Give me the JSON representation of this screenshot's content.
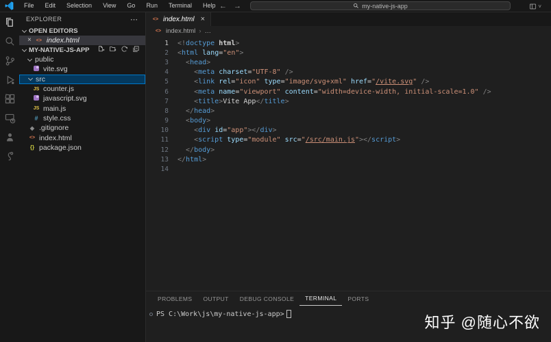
{
  "titlebar": {
    "menus": [
      "File",
      "Edit",
      "Selection",
      "View",
      "Go",
      "Run",
      "Terminal",
      "Help"
    ],
    "back_arrow": "←",
    "forward_arrow": "→",
    "search_value": "my-native-js-app",
    "layout_chevron": "˅"
  },
  "activity_bar": {
    "items": [
      {
        "icon": "explorer",
        "active": true
      },
      {
        "icon": "search",
        "active": false
      },
      {
        "icon": "source-control",
        "active": false
      },
      {
        "icon": "run-debug",
        "active": false
      },
      {
        "icon": "extensions",
        "active": false
      },
      {
        "icon": "remote-explorer",
        "active": false
      },
      {
        "icon": "account",
        "active": false
      },
      {
        "icon": "extension-misc",
        "active": false
      }
    ]
  },
  "sidebar": {
    "title": "EXPLORER",
    "more_label": "⋯",
    "open_editors": {
      "label": "OPEN EDITORS",
      "items": [
        {
          "close": "×",
          "icon": "html",
          "label": "index.html"
        }
      ]
    },
    "project": {
      "label": "MY-NATIVE-JS-APP",
      "actions": [
        "new-file",
        "new-folder",
        "refresh",
        "collapse-all"
      ]
    },
    "tree": [
      {
        "label": "public",
        "type": "folder",
        "indent": 0,
        "expanded": true,
        "selected": false
      },
      {
        "label": "vite.svg",
        "type": "svg",
        "indent": 1,
        "selected": false
      },
      {
        "label": "src",
        "type": "folder",
        "indent": 0,
        "expanded": true,
        "selected": true
      },
      {
        "label": "counter.js",
        "type": "js",
        "indent": 1,
        "selected": false
      },
      {
        "label": "javascript.svg",
        "type": "svg",
        "indent": 1,
        "selected": false
      },
      {
        "label": "main.js",
        "type": "js",
        "indent": 1,
        "selected": false
      },
      {
        "label": "style.css",
        "type": "css",
        "indent": 1,
        "selected": false
      },
      {
        "label": ".gitignore",
        "type": "git",
        "indent": 0,
        "selected": false
      },
      {
        "label": "index.html",
        "type": "html",
        "indent": 0,
        "selected": false
      },
      {
        "label": "package.json",
        "type": "json",
        "indent": 0,
        "selected": false
      }
    ]
  },
  "editor": {
    "tab": {
      "icon": "html",
      "label": "index.html",
      "close": "×"
    },
    "breadcrumb": {
      "file": "index.html",
      "sep": "›",
      "more": "…"
    },
    "code_lines": [
      [
        [
          "p",
          "<!"
        ],
        [
          "t",
          "doctype"
        ],
        [
          "w",
          " "
        ],
        [
          "b",
          "html"
        ],
        [
          "p",
          ">"
        ]
      ],
      [
        [
          "p",
          "<"
        ],
        [
          "t",
          "html"
        ],
        [
          "w",
          " "
        ],
        [
          "a",
          "lang"
        ],
        [
          "e",
          "="
        ],
        [
          "s",
          "\"en\""
        ],
        [
          "p",
          ">"
        ]
      ],
      [
        [
          "g",
          "  "
        ],
        [
          "p",
          "<"
        ],
        [
          "t",
          "head"
        ],
        [
          "p",
          ">"
        ]
      ],
      [
        [
          "g",
          "  "
        ],
        [
          "g",
          "  "
        ],
        [
          "p",
          "<"
        ],
        [
          "t",
          "meta"
        ],
        [
          "w",
          " "
        ],
        [
          "a",
          "charset"
        ],
        [
          "e",
          "="
        ],
        [
          "s",
          "\"UTF-8\""
        ],
        [
          "w",
          " "
        ],
        [
          "p",
          "/>"
        ]
      ],
      [
        [
          "g",
          "  "
        ],
        [
          "g",
          "  "
        ],
        [
          "p",
          "<"
        ],
        [
          "t",
          "link"
        ],
        [
          "w",
          " "
        ],
        [
          "a",
          "rel"
        ],
        [
          "e",
          "="
        ],
        [
          "s",
          "\"icon\""
        ],
        [
          "w",
          " "
        ],
        [
          "a",
          "type"
        ],
        [
          "e",
          "="
        ],
        [
          "s",
          "\"image/svg+xml\""
        ],
        [
          "w",
          " "
        ],
        [
          "a",
          "href"
        ],
        [
          "e",
          "="
        ],
        [
          "s",
          "\""
        ],
        [
          "l",
          "/vite.svg"
        ],
        [
          "s",
          "\""
        ],
        [
          "w",
          " "
        ],
        [
          "p",
          "/>"
        ]
      ],
      [
        [
          "g",
          "  "
        ],
        [
          "g",
          "  "
        ],
        [
          "p",
          "<"
        ],
        [
          "t",
          "meta"
        ],
        [
          "w",
          " "
        ],
        [
          "a",
          "name"
        ],
        [
          "e",
          "="
        ],
        [
          "s",
          "\"viewport\""
        ],
        [
          "w",
          " "
        ],
        [
          "a",
          "content"
        ],
        [
          "e",
          "="
        ],
        [
          "s",
          "\"width=device-width, initial-scale=1.0\""
        ],
        [
          "w",
          " "
        ],
        [
          "p",
          "/>"
        ]
      ],
      [
        [
          "g",
          "  "
        ],
        [
          "g",
          "  "
        ],
        [
          "p",
          "<"
        ],
        [
          "t",
          "title"
        ],
        [
          "p",
          ">"
        ],
        [
          "x",
          "Vite App"
        ],
        [
          "p",
          "</"
        ],
        [
          "t",
          "title"
        ],
        [
          "p",
          ">"
        ]
      ],
      [
        [
          "g",
          "  "
        ],
        [
          "p",
          "</"
        ],
        [
          "t",
          "head"
        ],
        [
          "p",
          ">"
        ]
      ],
      [
        [
          "g",
          "  "
        ],
        [
          "p",
          "<"
        ],
        [
          "t",
          "body"
        ],
        [
          "p",
          ">"
        ]
      ],
      [
        [
          "g",
          "  "
        ],
        [
          "g",
          "  "
        ],
        [
          "p",
          "<"
        ],
        [
          "t",
          "div"
        ],
        [
          "w",
          " "
        ],
        [
          "a",
          "id"
        ],
        [
          "e",
          "="
        ],
        [
          "s",
          "\"app\""
        ],
        [
          "p",
          "></"
        ],
        [
          "t",
          "div"
        ],
        [
          "p",
          ">"
        ]
      ],
      [
        [
          "g",
          "  "
        ],
        [
          "g",
          "  "
        ],
        [
          "p",
          "<"
        ],
        [
          "t",
          "script"
        ],
        [
          "w",
          " "
        ],
        [
          "a",
          "type"
        ],
        [
          "e",
          "="
        ],
        [
          "s",
          "\"module\""
        ],
        [
          "w",
          " "
        ],
        [
          "a",
          "src"
        ],
        [
          "e",
          "="
        ],
        [
          "s",
          "\""
        ],
        [
          "l",
          "/src/main.js"
        ],
        [
          "s",
          "\""
        ],
        [
          "p",
          "></"
        ],
        [
          "t",
          "script"
        ],
        [
          "p",
          ">"
        ]
      ],
      [
        [
          "g",
          "  "
        ],
        [
          "p",
          "</"
        ],
        [
          "t",
          "body"
        ],
        [
          "p",
          ">"
        ]
      ],
      [
        [
          "p",
          "</"
        ],
        [
          "t",
          "html"
        ],
        [
          "p",
          ">"
        ]
      ],
      []
    ]
  },
  "panel": {
    "tabs": [
      {
        "label": "PROBLEMS",
        "active": false
      },
      {
        "label": "OUTPUT",
        "active": false
      },
      {
        "label": "DEBUG CONSOLE",
        "active": false
      },
      {
        "label": "TERMINAL",
        "active": true
      },
      {
        "label": "PORTS",
        "active": false
      }
    ],
    "terminal_prompt": "PS C:\\Work\\js\\my-native-js-app>"
  },
  "watermark": "知乎 @随心不欲",
  "colors": {
    "accent": "#007fd4",
    "selection_bg": "#04395e",
    "tag": "#569cd6",
    "attribute": "#9cdcfe",
    "string": "#ce9178",
    "punctuation": "#808080",
    "html_icon": "#e07b53",
    "js_icon": "#e8c84a",
    "css_icon": "#519aba",
    "svg_icon": "#a074c4",
    "json_icon": "#cbcb41"
  }
}
